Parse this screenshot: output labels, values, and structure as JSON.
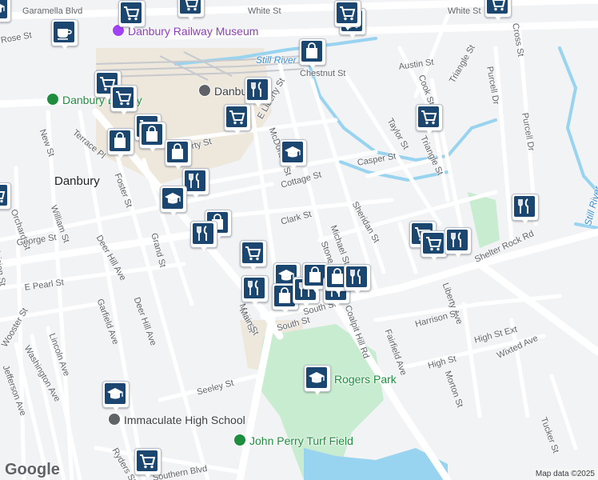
{
  "attribution": {
    "logo": "Google",
    "copyright": "Map data ©2025"
  },
  "colors": {
    "marker": "#1a4670",
    "road": "#ffffff",
    "park": "#c8ecd0",
    "water": "#98d3f0",
    "land": "#f2f3f5"
  },
  "places": [
    {
      "name": "Danbury",
      "kind": "city"
    },
    {
      "name": "Danbury",
      "kind": "poi-gray",
      "icon": "train-icon"
    },
    {
      "name": "Danbury Railway Museum",
      "kind": "poi-purple",
      "icon": "museum-icon"
    },
    {
      "name": "Still River",
      "kind": "water"
    },
    {
      "name": "Still River",
      "kind": "water"
    },
    {
      "name": "Rogers Park",
      "kind": "poi-green",
      "icon": "tree-icon"
    },
    {
      "name": "John Perry Turf Field",
      "kind": "poi-green",
      "icon": "sport-icon"
    },
    {
      "name": "Immaculate High School",
      "kind": "poi-gray",
      "icon": "school-icon"
    },
    {
      "name": "Danbury Library",
      "kind": "poi-green",
      "icon": "tree-icon"
    }
  ],
  "streets": [
    "Garamella Blvd",
    "White St",
    "White St",
    "Chestnut St",
    "Austin St",
    "Cook St",
    "Triangle St",
    "Purcell Dr",
    "Cross St",
    "Purcell Dr",
    "Taylor St",
    "Casper St",
    "Triangle St",
    "Sheridan St",
    "Shelter Rock Rd",
    "E Liberty St",
    "McDonald St",
    "Liberty St",
    "Cottage St",
    "Clark St",
    "Terrace Pl",
    "New St",
    "Foster St",
    "William St",
    "Orchard St",
    "George St",
    "Division St",
    "E Pearl St",
    "Deer Hill Ave",
    "Deer Hill Ave",
    "Grand St",
    "Garfield Ave",
    "Main St",
    "South St",
    "South St",
    "Michael St",
    "Stone St",
    "Coalpit Hill Rd",
    "Fairfield Ave",
    "Liberty Ave",
    "Harrison St",
    "High St Ext",
    "High St",
    "Wixted Ave",
    "Morton St",
    "Seeley St",
    "Wooster St",
    "Washington Ave",
    "Lincoln Ave",
    "Jefferson Ave",
    "Ryders St",
    "Tucker St",
    "Southern Blvd",
    "Rose St",
    "Main St"
  ],
  "markers": [
    {
      "icon": "coffee-icon",
      "label": "Cafe"
    },
    {
      "icon": "cart-icon",
      "label": "Store"
    },
    {
      "icon": "cart-icon",
      "label": "Store"
    },
    {
      "icon": "cart-icon",
      "label": "Store"
    },
    {
      "icon": "cart-icon",
      "label": "Store"
    },
    {
      "icon": "bag-icon",
      "label": "Shop"
    },
    {
      "icon": "cart-icon",
      "label": "Store"
    },
    {
      "icon": "utensils-icon",
      "label": "Restaurant"
    },
    {
      "icon": "cart-icon",
      "label": "Store"
    },
    {
      "icon": "cart-icon",
      "label": "Store"
    },
    {
      "icon": "cart-icon",
      "label": "Store"
    },
    {
      "icon": "bag-icon",
      "label": "Shop"
    },
    {
      "icon": "bag-icon",
      "label": "Shop"
    },
    {
      "icon": "bag-icon",
      "label": "Shop"
    },
    {
      "icon": "school-icon",
      "label": "School"
    },
    {
      "icon": "utensils-icon",
      "label": "Restaurant"
    },
    {
      "icon": "school-icon",
      "label": "School"
    },
    {
      "icon": "bag-icon",
      "label": "Shop"
    },
    {
      "icon": "utensils-icon",
      "label": "Restaurant"
    },
    {
      "icon": "cart-icon",
      "label": "Store"
    },
    {
      "icon": "utensils-icon",
      "label": "Restaurant"
    },
    {
      "icon": "school-icon",
      "label": "School"
    },
    {
      "icon": "bag-icon",
      "label": "Shop"
    },
    {
      "icon": "utensils-icon",
      "label": "Restaurant"
    },
    {
      "icon": "bag-icon",
      "label": "Shop"
    },
    {
      "icon": "utensils-icon",
      "label": "Restaurant"
    },
    {
      "icon": "bag-icon",
      "label": "Shop"
    },
    {
      "icon": "utensils-icon",
      "label": "Restaurant"
    },
    {
      "icon": "cart-icon",
      "label": "Store"
    },
    {
      "icon": "cart-icon",
      "label": "Store"
    },
    {
      "icon": "utensils-icon",
      "label": "Restaurant"
    },
    {
      "icon": "cart-icon",
      "label": "Store"
    },
    {
      "icon": "utensils-icon",
      "label": "Restaurant"
    },
    {
      "icon": "school-icon",
      "label": "School"
    },
    {
      "icon": "school-icon",
      "label": "School"
    },
    {
      "icon": "cart-icon",
      "label": "Store"
    },
    {
      "icon": "cart-icon",
      "label": "Store"
    },
    {
      "icon": "cart-icon",
      "label": "Store"
    },
    {
      "icon": "school-icon",
      "label": "School"
    }
  ]
}
